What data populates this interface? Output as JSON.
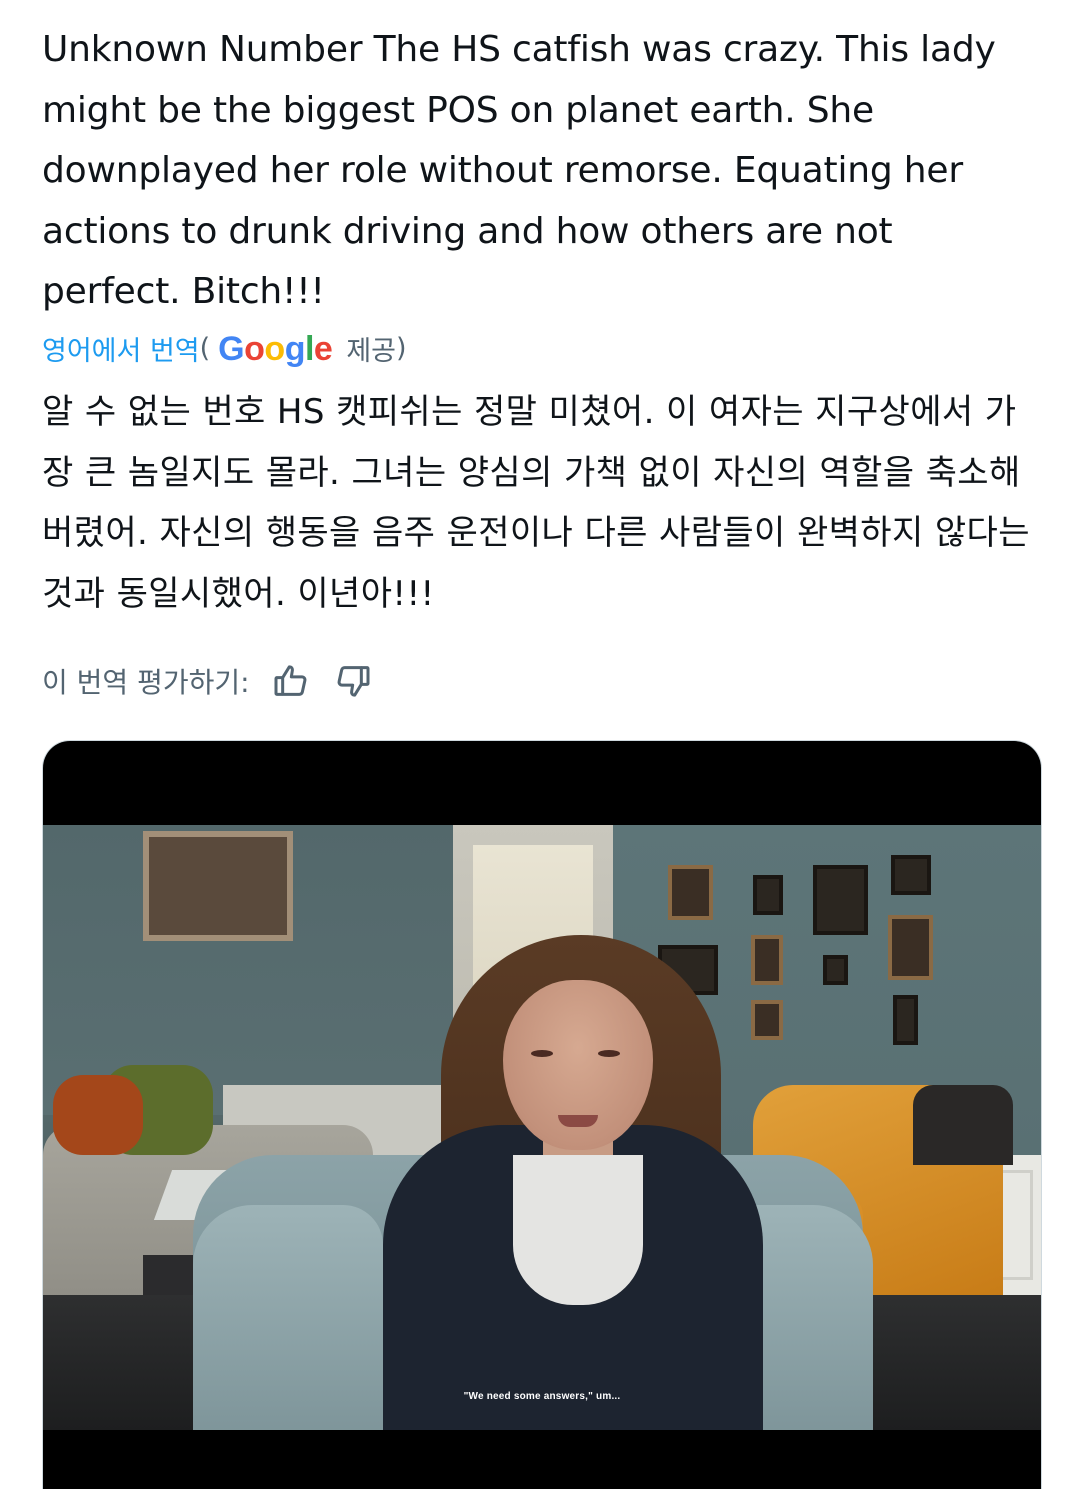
{
  "tweet": {
    "original_text": "Unknown Number The HS catfish was crazy. This lady might be the biggest POS on planet earth. She downplayed her role without remorse. Equating her actions to drunk driving and how others are not perfect. Bitch!!!",
    "translation_link": "영어에서 번역",
    "translation_paren_open": "(",
    "translation_provider": "Google",
    "translation_provided": "제공",
    "translation_paren_close": ")",
    "translated_text": "알 수 없는 번호 HS 캣피쉬는 정말 미쳤어. 이 여자는 지구상에서 가장 큰 놈일지도 몰라. 그녀는 양심의 가책 없이 자신의 역할을 축소해 버렸어. 자신의 행동을 음주 운전이나 다른 사람들이 완벽하지 않다는 것과 동일시했어. 이년아!!!",
    "rate_label": "이 번역 평가하기:"
  },
  "media": {
    "subtitle": "\"We need some answers,\" um..."
  },
  "icons": {
    "thumbs_up": "thumbs-up-icon",
    "thumbs_down": "thumbs-down-icon"
  },
  "colors": {
    "link": "#1d9bf0",
    "muted": "#536471",
    "text": "#0f1419"
  }
}
